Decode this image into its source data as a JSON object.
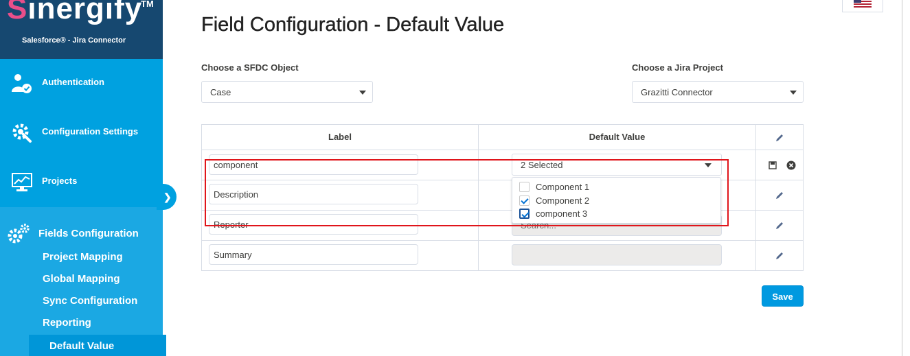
{
  "brand": {
    "name_first_letter": "S",
    "name_rest": "inergify",
    "trademark": "TM",
    "tagline": "Salesforce® - Jira Connector",
    "accent_color": "#e94f8a"
  },
  "sidebar": {
    "items": [
      {
        "label": "Authentication",
        "icon": "user-check-icon"
      },
      {
        "label": "Configuration Settings",
        "icon": "wrench-gear-icon"
      },
      {
        "label": "Projects",
        "icon": "monitor-chart-icon"
      }
    ],
    "fields_configuration": {
      "label": "Fields Configuration",
      "icon": "gears-icon",
      "subitems": [
        {
          "label": "Project Mapping"
        },
        {
          "label": "Global Mapping"
        },
        {
          "label": "Sync Configuration"
        },
        {
          "label": "Reporting"
        },
        {
          "label": "Default Value",
          "active": true
        }
      ]
    },
    "colors": {
      "primary": "#00a1e0",
      "brand_bg": "#164870",
      "active_bg": "#0096d8"
    }
  },
  "header": {
    "title": "Field Configuration - Default Value",
    "language_flag": "us-flag-icon"
  },
  "filters": {
    "sfdc_object": {
      "label": "Choose a SFDC Object",
      "value": "Case"
    },
    "jira_project": {
      "label": "Choose a Jira Project",
      "value": "Grazitti Connector"
    }
  },
  "table": {
    "columns": [
      "Label",
      "Default Value"
    ],
    "header_action_icon": "pencil-icon",
    "rows": [
      {
        "label": "component",
        "default_value": "2 Selected",
        "editing": true
      },
      {
        "label": "Description",
        "default_value": ""
      },
      {
        "label": "Reporter",
        "default_value": "Search..."
      },
      {
        "label": "Summary",
        "default_value": ""
      }
    ],
    "dropdown_options": [
      {
        "label": "Component 1",
        "checked": false
      },
      {
        "label": "Component 2",
        "checked": true
      },
      {
        "label": "component 3",
        "checked": true
      }
    ]
  },
  "actions": {
    "save_label": "Save",
    "save_color": "#0099e0"
  },
  "highlight_color": "#e0151b"
}
